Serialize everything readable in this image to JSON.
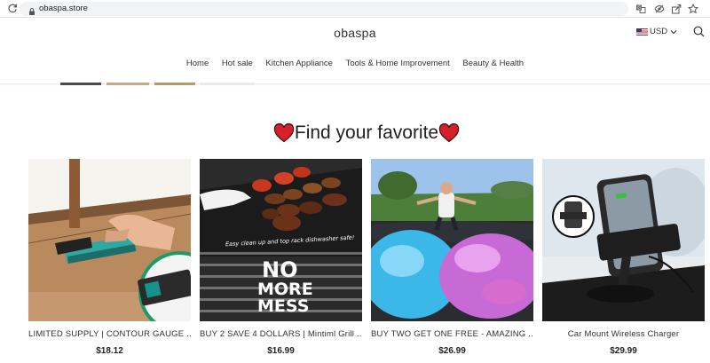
{
  "browser": {
    "url": "obaspa.store"
  },
  "site": {
    "logo": "obaspa",
    "currency": "USD",
    "nav": [
      "Home",
      "Hot sale",
      "Kitchen Appliance",
      "Tools & Home Improvement",
      "Beauty & Health"
    ]
  },
  "section": {
    "title": "Find your favorite"
  },
  "products": [
    {
      "title": "LIMITED SUPPLY | CONTOUR GAUGE ...",
      "price": "$18.12",
      "image": "contour-gauge"
    },
    {
      "title": "BUY 2 SAVE 4 DOLLARS | Mintiml Grill ...",
      "price": "$16.99",
      "image": "grill-mat",
      "overlay_small": "Easy clean up and top rack dishwasher safe!",
      "overlay_big": [
        "NO",
        "MORE",
        "MESS"
      ]
    },
    {
      "title": "BUY TWO GET ONE FREE - AMAZING ...",
      "price": "$26.99",
      "image": "water-balls"
    },
    {
      "title": "Car Mount Wireless Charger",
      "price": "$29.99",
      "image": "car-charger"
    }
  ],
  "colors": {
    "accent": "#d61f26",
    "teal": "#0e8f8b"
  }
}
